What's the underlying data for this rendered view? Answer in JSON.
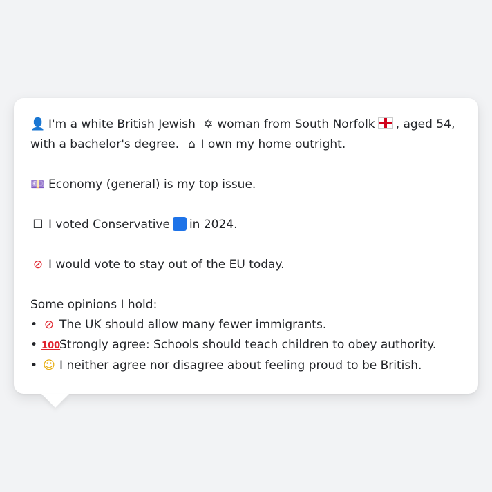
{
  "persona": {
    "intro": {
      "icon": "person-silhouette-icon",
      "part1": "I'm a white British Jewish",
      "part1_icon": "star-of-david-icon",
      "part2": "woman from South Norfolk",
      "part2_icon": "england-flag-icon",
      "part3": ", aged 54,",
      "line2_start": "with a bachelor's degree.",
      "line2_icon": "house-icon",
      "line2_end": "I own my home outright."
    },
    "issue": {
      "icon": "money-icon",
      "text": "Economy (general) is my top issue."
    },
    "vote": {
      "icon": "ballot-box-icon",
      "part1": "I voted Conservative",
      "party_color": "#1e73e8",
      "part2": "in 2024."
    },
    "eu": {
      "icon": "prohibited-icon",
      "text": "I would vote to stay out of the EU today."
    },
    "opinions": {
      "heading": "Some opinions I hold:",
      "items": [
        {
          "icon": "prohibited-icon",
          "text": "The UK should allow many fewer immigrants."
        },
        {
          "icon": "hundred-points-icon",
          "text": "Strongly agree: Schools should teach children to obey authority."
        },
        {
          "icon": "thinking-face-icon",
          "text": "I neither agree nor disagree about feeling proud to be British."
        }
      ]
    }
  }
}
